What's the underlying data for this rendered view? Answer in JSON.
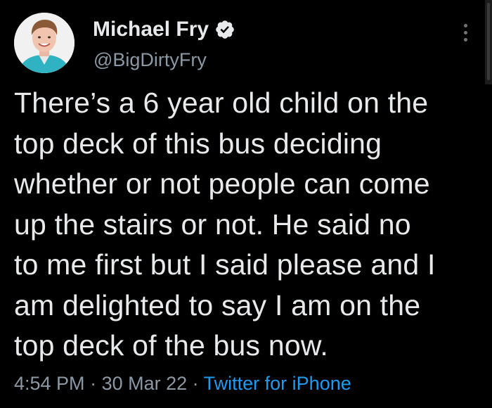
{
  "author": {
    "display_name": "Michael Fry",
    "handle": "@BigDirtyFry",
    "verified_icon": "verified-badge-icon",
    "avatar": "profile-photo"
  },
  "menu": {
    "icon": "more-options-icon"
  },
  "tweet": {
    "lines": [
      "There’s a 6 year old child on the",
      "top deck of this bus deciding",
      "whether or not people can come",
      "up the stairs or not. He said no",
      "to me first but I said please and I",
      "am delighted to say I am on the",
      "top deck of the bus now."
    ]
  },
  "meta": {
    "time": "4:54 PM",
    "separator": " · ",
    "date": "30 Mar 22",
    "source": "Twitter for iPhone"
  },
  "colors": {
    "background": "#000000",
    "text": "#e7e9ea",
    "secondary": "#8b98a5",
    "link": "#1d9bf0",
    "verified_badge": "#e7e9ea"
  }
}
